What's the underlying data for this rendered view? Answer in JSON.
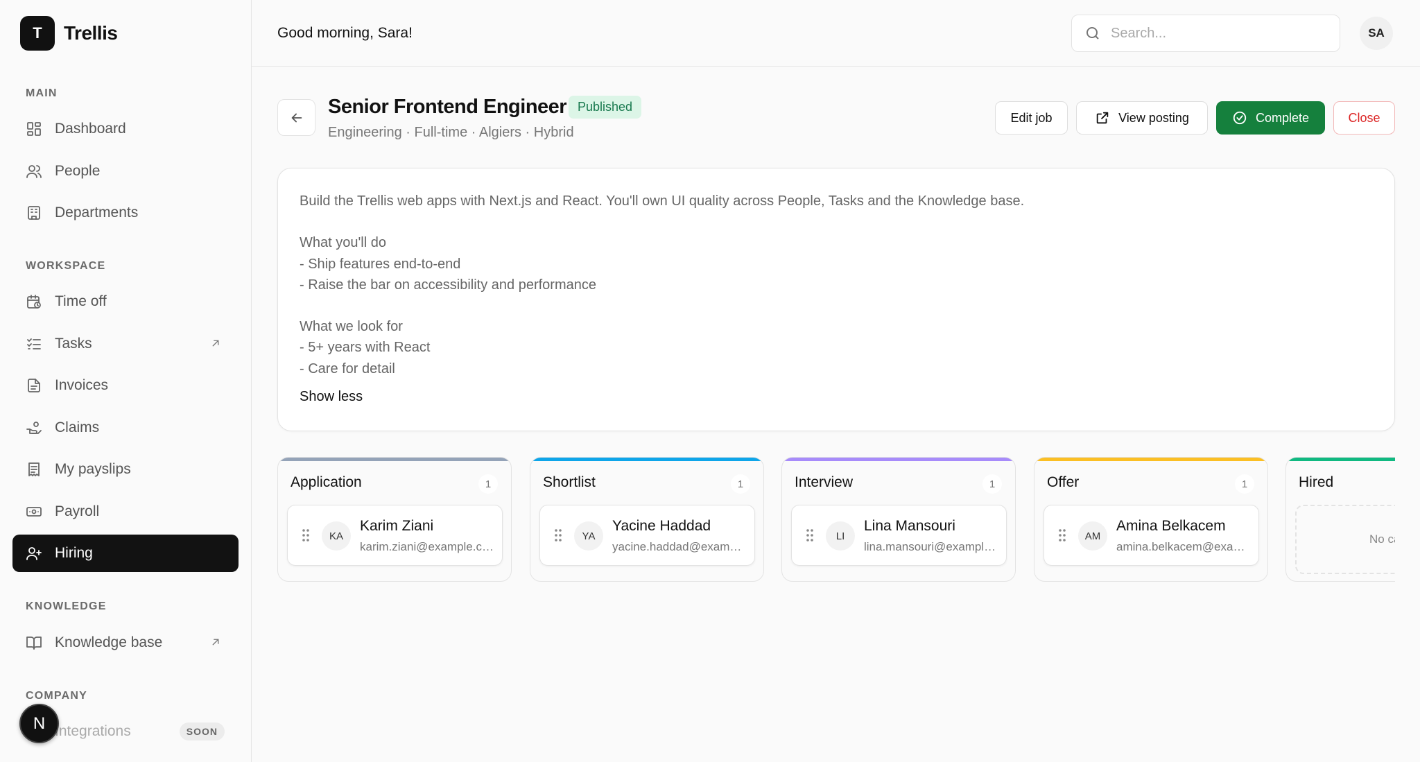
{
  "brand": {
    "logo_letter": "T",
    "name": "Trellis"
  },
  "sidebar": {
    "sections": {
      "main": "MAIN",
      "workspace": "WORKSPACE",
      "knowledge": "KNOWLEDGE",
      "company": "COMPANY"
    },
    "items": {
      "dashboard": "Dashboard",
      "people": "People",
      "departments": "Departments",
      "time_off": "Time off",
      "tasks": "Tasks",
      "invoices": "Invoices",
      "claims": "Claims",
      "payslips": "My payslips",
      "payroll": "Payroll",
      "hiring": "Hiring",
      "knowledge_base": "Knowledge base",
      "integrations": "Integrations"
    },
    "soon_badge": "SOON",
    "n_badge": "N",
    "active": "hiring"
  },
  "topbar": {
    "greeting": "Good morning, Sara!",
    "search_placeholder": "Search...",
    "avatar": "SA"
  },
  "job": {
    "title": "Senior Frontend Engineer",
    "status": "Published",
    "meta": "Engineering · Full-time · Algiers · Hybrid",
    "description": "Build the Trellis web apps with Next.js and React. You'll own UI quality across People, Tasks and the Knowledge base.\n\nWhat you'll do\n- Ship features end-to-end\n- Raise the bar on accessibility and performance\n\nWhat we look for\n- 5+ years with React\n- Care for detail",
    "show_less": "Show less"
  },
  "actions": {
    "edit": "Edit job",
    "view": "View posting",
    "complete": "Complete",
    "close": "Close"
  },
  "colors": {
    "application": "#94a3b8",
    "shortlist": "#0ea5e9",
    "interview": "#a78bfa",
    "offer": "#fbbf24",
    "hired": "#10b981",
    "complete": "#15803d",
    "close": "#dc2626"
  },
  "pipeline": {
    "application": {
      "title": "Application",
      "count": "1",
      "candidate": {
        "initials": "KA",
        "name": "Karim Ziani",
        "email": "karim.ziani@example.com"
      }
    },
    "shortlist": {
      "title": "Shortlist",
      "count": "1",
      "candidate": {
        "initials": "YA",
        "name": "Yacine Haddad",
        "email": "yacine.haddad@example.com"
      }
    },
    "interview": {
      "title": "Interview",
      "count": "1",
      "candidate": {
        "initials": "LI",
        "name": "Lina Mansouri",
        "email": "lina.mansouri@example.com"
      }
    },
    "offer": {
      "title": "Offer",
      "count": "1",
      "candidate": {
        "initials": "AM",
        "name": "Amina Belkacem",
        "email": "amina.belkacem@example.com"
      }
    },
    "hired": {
      "title": "Hired",
      "empty_text": "No candidates"
    }
  }
}
